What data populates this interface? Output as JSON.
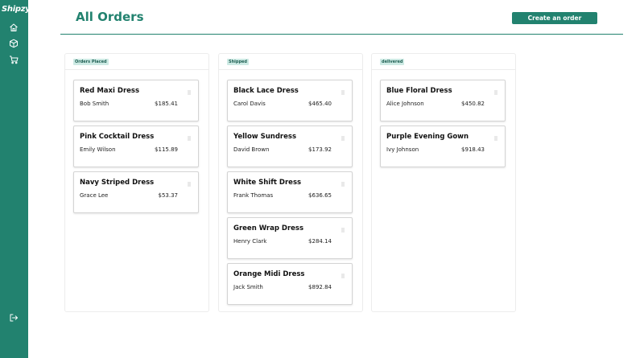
{
  "app": {
    "brand": "Shipzy",
    "accent": "#22826f"
  },
  "sidebar": {
    "items": [
      {
        "icon": "home-icon"
      },
      {
        "icon": "package-icon"
      },
      {
        "icon": "cart-icon"
      }
    ],
    "footer_icon": "logout-icon"
  },
  "header": {
    "title": "All Orders",
    "create_label": "Create an order"
  },
  "columns": [
    {
      "status": "Orders Placed",
      "cards": [
        {
          "name": "Red Maxi Dress",
          "customer": "Bob Smith",
          "price": "$185.41"
        },
        {
          "name": "Pink Cocktail Dress",
          "customer": "Emily Wilson",
          "price": "$115.89"
        },
        {
          "name": "Navy Striped Dress",
          "customer": "Grace Lee",
          "price": "$53.37"
        }
      ]
    },
    {
      "status": "Shipped",
      "cards": [
        {
          "name": "Black Lace Dress",
          "customer": "Carol Davis",
          "price": "$465.40"
        },
        {
          "name": "Yellow Sundress",
          "customer": "David Brown",
          "price": "$173.92"
        },
        {
          "name": "White Shift Dress",
          "customer": "Frank Thomas",
          "price": "$636.65"
        },
        {
          "name": "Green Wrap Dress",
          "customer": "Henry Clark",
          "price": "$284.14"
        },
        {
          "name": "Orange Midi Dress",
          "customer": "Jack Smith",
          "price": "$892.84"
        }
      ]
    },
    {
      "status": "delivered",
      "cards": [
        {
          "name": "Blue Floral Dress",
          "customer": "Alice Johnson",
          "price": "$450.82"
        },
        {
          "name": "Purple Evening Gown",
          "customer": "Ivy Johnson",
          "price": "$918.43"
        }
      ]
    }
  ]
}
